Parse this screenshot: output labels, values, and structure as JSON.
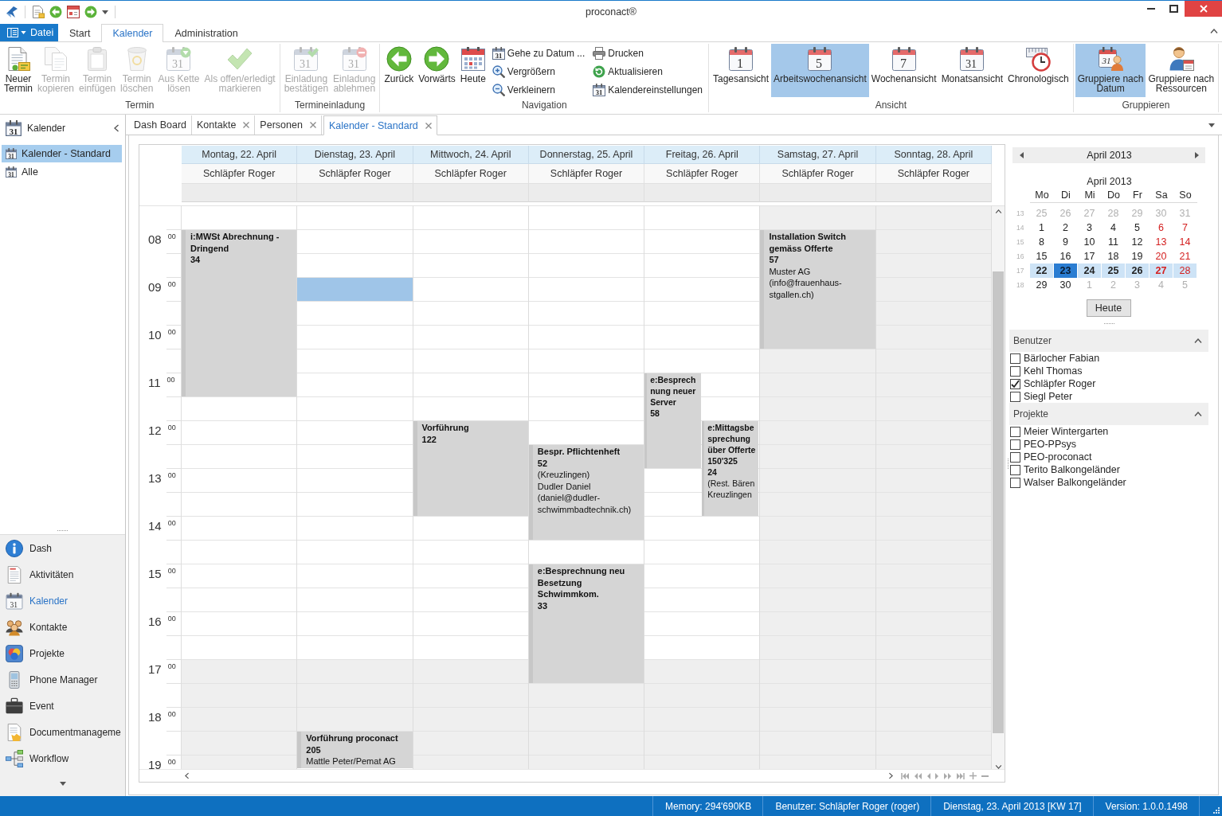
{
  "window": {
    "title": "proconact®"
  },
  "ribbon": {
    "file_button": "Datei",
    "tabs": [
      {
        "label": "Start",
        "selected": false
      },
      {
        "label": "Kalender",
        "selected": true
      },
      {
        "label": "Administration",
        "selected": false
      }
    ],
    "groups": [
      {
        "label": "Termin",
        "items": [
          {
            "kind": "large",
            "lines": [
              "Neuer",
              "Termin"
            ],
            "disabled": false
          },
          {
            "kind": "large",
            "lines": [
              "Termin",
              "kopieren"
            ],
            "disabled": true
          },
          {
            "kind": "large",
            "lines": [
              "Termin",
              "einfügen"
            ],
            "disabled": true
          },
          {
            "kind": "large",
            "lines": [
              "Termin",
              "löschen"
            ],
            "disabled": true
          },
          {
            "kind": "large",
            "lines": [
              "Aus Kette",
              "lösen"
            ],
            "disabled": true,
            "icon_text": "31"
          },
          {
            "kind": "large",
            "lines": [
              "Als offen/erledigt",
              "markieren"
            ],
            "disabled": true
          }
        ]
      },
      {
        "label": "Termineinladung",
        "items": [
          {
            "kind": "large",
            "lines": [
              "Einladung",
              "bestätigen"
            ],
            "disabled": true,
            "icon_text": "31"
          },
          {
            "kind": "large",
            "lines": [
              "Einladung",
              "ablehmen"
            ],
            "disabled": true,
            "icon_text": "31"
          }
        ]
      },
      {
        "label": "Navigation",
        "items": [
          {
            "kind": "large",
            "lines": [
              "Zurück"
            ],
            "disabled": false
          },
          {
            "kind": "large",
            "lines": [
              "Vorwärts"
            ],
            "disabled": false
          },
          {
            "kind": "large",
            "lines": [
              "Heute"
            ],
            "disabled": false
          },
          {
            "kind": "small",
            "lines": [
              "Gehe zu Datum ..."
            ],
            "disabled": false,
            "icon_text": "31"
          },
          {
            "kind": "small",
            "lines": [
              "Vergrößern"
            ],
            "disabled": false
          },
          {
            "kind": "small",
            "lines": [
              "Verkleinern"
            ],
            "disabled": false
          },
          {
            "kind": "small",
            "lines": [
              "Drucken"
            ],
            "disabled": false
          },
          {
            "kind": "small",
            "lines": [
              "Aktualisieren"
            ],
            "disabled": false
          },
          {
            "kind": "small",
            "lines": [
              "Kalendereinstellungen"
            ],
            "disabled": false,
            "icon_text": "31"
          }
        ]
      },
      {
        "label": "Ansicht",
        "items": [
          {
            "kind": "large",
            "lines": [
              "Tagesansicht"
            ],
            "disabled": false,
            "selected": false,
            "icon_text": "1"
          },
          {
            "kind": "large",
            "lines": [
              "Arbeitswochenansicht"
            ],
            "disabled": false,
            "selected": true,
            "icon_text": "5"
          },
          {
            "kind": "large",
            "lines": [
              "Wochenansicht"
            ],
            "disabled": false,
            "selected": false,
            "icon_text": "7"
          },
          {
            "kind": "large",
            "lines": [
              "Monatsansicht"
            ],
            "disabled": false,
            "selected": false,
            "icon_text": "31"
          },
          {
            "kind": "large",
            "lines": [
              "Chronologisch"
            ],
            "disabled": false,
            "selected": false
          }
        ]
      },
      {
        "label": "Gruppieren",
        "items": [
          {
            "kind": "large",
            "lines": [
              "Gruppiere nach",
              "Datum"
            ],
            "disabled": false,
            "selected": true,
            "icon_text": "31"
          },
          {
            "kind": "large",
            "lines": [
              "Gruppiere nach",
              "Ressourcen"
            ],
            "disabled": false,
            "selected": false
          }
        ]
      }
    ]
  },
  "sidebar": {
    "title": "Kalender",
    "icon_text": "31",
    "tree": [
      {
        "label": "Kalender - Standard",
        "icon_text": "31",
        "selected": true
      },
      {
        "label": "Alle",
        "icon_text": "31",
        "selected": false
      }
    ],
    "nav": [
      {
        "label": "Dash",
        "selected": false
      },
      {
        "label": "Aktivitäten",
        "selected": false
      },
      {
        "label": "Kalender",
        "icon_text": "31",
        "selected": true
      },
      {
        "label": "Kontakte",
        "selected": false
      },
      {
        "label": "Projekte",
        "selected": false
      },
      {
        "label": "Phone Manager",
        "selected": false
      },
      {
        "label": "Event",
        "selected": false
      },
      {
        "label": "Documentmanageme",
        "selected": false
      },
      {
        "label": "Workflow",
        "selected": false
      }
    ]
  },
  "document_tabs": [
    {
      "label": "Dash Board",
      "closable": false,
      "selected": false
    },
    {
      "label": "Kontakte",
      "closable": true,
      "selected": false
    },
    {
      "label": "Personen",
      "closable": true,
      "selected": false
    },
    {
      "label": "Kalender - Standard",
      "closable": true,
      "selected": true
    }
  ],
  "calendar": {
    "hours": [
      {
        "hour": "08",
        "minutes": "00",
        "working": true
      },
      {
        "hour": "09",
        "minutes": "00",
        "working": true
      },
      {
        "hour": "10",
        "minutes": "00",
        "working": true
      },
      {
        "hour": "11",
        "minutes": "00",
        "working": true
      },
      {
        "hour": "12",
        "minutes": "00",
        "working": true
      },
      {
        "hour": "13",
        "minutes": "00",
        "working": true
      },
      {
        "hour": "14",
        "minutes": "00",
        "working": true
      },
      {
        "hour": "15",
        "minutes": "00",
        "working": true
      },
      {
        "hour": "16",
        "minutes": "00",
        "working": true
      },
      {
        "hour": "17",
        "minutes": "00",
        "working": false
      },
      {
        "hour": "18",
        "minutes": "00",
        "working": false
      },
      {
        "hour": "19",
        "minutes": "00",
        "working": false
      }
    ],
    "days": [
      {
        "label": "Montag, 22. April",
        "resource": "Schläpfer Roger",
        "weekend": false,
        "selected": false,
        "events": [
          {
            "title": "i:MWSt Abrechnung - Dringend",
            "number": "34"
          }
        ]
      },
      {
        "label": "Dienstag, 23. April",
        "resource": "Schläpfer Roger",
        "weekend": false,
        "selected": true,
        "events": [
          {
            "title": "Vorführung proconact",
            "number": "205",
            "details": [
              "Mattle Peter/Pemat AG"
            ]
          }
        ]
      },
      {
        "label": "Mittwoch, 24. April",
        "resource": "Schläpfer Roger",
        "weekend": false,
        "selected": false,
        "events": [
          {
            "title": "Vorführung",
            "number": "122"
          }
        ]
      },
      {
        "label": "Donnerstag, 25. April",
        "resource": "Schläpfer Roger",
        "weekend": false,
        "selected": false,
        "events": [
          {
            "title": "Bespr. Pflichtenheft",
            "number": "52",
            "details": [
              "(Kreuzlingen)",
              "Dudler Daniel",
              "(daniel@dudler-schwimmbadtechnik.ch)"
            ]
          },
          {
            "title": "e:Besprechnung neu Besetzung Schwimmkom.",
            "number": "33"
          }
        ]
      },
      {
        "label": "Freitag, 26. April",
        "resource": "Schläpfer Roger",
        "weekend": false,
        "selected": false,
        "events": [
          {
            "title": "e:Besprechnung neuer Server",
            "number": "58"
          },
          {
            "title": "e:Mittagsbesprechung über Offerte 150'325",
            "number": "24",
            "details": [
              "(Rest. Bären Kreuzlingen"
            ]
          }
        ]
      },
      {
        "label": "Samstag, 27. April",
        "resource": "Schläpfer Roger",
        "weekend": true,
        "selected": false,
        "events": [
          {
            "title": "Installation Switch gemäss Offerte",
            "number": "57",
            "details": [
              "Muster AG",
              "(info@frauenhaus-stgallen.ch)"
            ]
          }
        ]
      },
      {
        "label": "Sonntag, 28. April",
        "resource": "Schläpfer Roger",
        "weekend": true,
        "selected": false
      }
    ]
  },
  "mini_calendar": {
    "title": "April 2013",
    "month_label": "April 2013",
    "weekdays": [
      "Mo",
      "Di",
      "Mi",
      "Do",
      "Fr",
      "Sa",
      "So"
    ],
    "weeks": [
      {
        "number": "13",
        "selected": false,
        "days": [
          {
            "day": "25",
            "other_month": true,
            "has_events": false,
            "selected": false
          },
          {
            "day": "26",
            "other_month": true,
            "has_events": false,
            "selected": false
          },
          {
            "day": "27",
            "other_month": true,
            "has_events": false,
            "selected": false
          },
          {
            "day": "28",
            "other_month": true,
            "has_events": false,
            "selected": false
          },
          {
            "day": "29",
            "other_month": true,
            "has_events": false,
            "selected": false
          },
          {
            "day": "30",
            "other_month": true,
            "has_events": false,
            "selected": false
          },
          {
            "day": "31",
            "other_month": true,
            "has_events": false,
            "selected": false
          }
        ]
      },
      {
        "number": "14",
        "selected": false,
        "days": [
          {
            "day": "1",
            "other_month": false,
            "has_events": false,
            "selected": false
          },
          {
            "day": "2",
            "other_month": false,
            "has_events": false,
            "selected": false
          },
          {
            "day": "3",
            "other_month": false,
            "has_events": false,
            "selected": false
          },
          {
            "day": "4",
            "other_month": false,
            "has_events": false,
            "selected": false
          },
          {
            "day": "5",
            "other_month": false,
            "has_events": false,
            "selected": false
          },
          {
            "day": "6",
            "other_month": false,
            "has_events": false,
            "selected": false
          },
          {
            "day": "7",
            "other_month": false,
            "has_events": false,
            "selected": false
          }
        ]
      },
      {
        "number": "15",
        "selected": false,
        "days": [
          {
            "day": "8",
            "other_month": false,
            "has_events": false,
            "selected": false
          },
          {
            "day": "9",
            "other_month": false,
            "has_events": false,
            "selected": false
          },
          {
            "day": "10",
            "other_month": false,
            "has_events": false,
            "selected": false
          },
          {
            "day": "11",
            "other_month": false,
            "has_events": false,
            "selected": false
          },
          {
            "day": "12",
            "other_month": false,
            "has_events": false,
            "selected": false
          },
          {
            "day": "13",
            "other_month": false,
            "has_events": false,
            "selected": false
          },
          {
            "day": "14",
            "other_month": false,
            "has_events": false,
            "selected": false
          }
        ]
      },
      {
        "number": "16",
        "selected": false,
        "days": [
          {
            "day": "15",
            "other_month": false,
            "has_events": false,
            "selected": false
          },
          {
            "day": "16",
            "other_month": false,
            "has_events": false,
            "selected": false
          },
          {
            "day": "17",
            "other_month": false,
            "has_events": false,
            "selected": false
          },
          {
            "day": "18",
            "other_month": false,
            "has_events": false,
            "selected": false
          },
          {
            "day": "19",
            "other_month": false,
            "has_events": false,
            "selected": false
          },
          {
            "day": "20",
            "other_month": false,
            "has_events": false,
            "selected": false
          },
          {
            "day": "21",
            "other_month": false,
            "has_events": false,
            "selected": false
          }
        ]
      },
      {
        "number": "17",
        "selected": true,
        "days": [
          {
            "day": "22",
            "other_month": false,
            "has_events": true,
            "selected": false
          },
          {
            "day": "23",
            "other_month": false,
            "has_events": true,
            "selected": true
          },
          {
            "day": "24",
            "other_month": false,
            "has_events": true,
            "selected": false
          },
          {
            "day": "25",
            "other_month": false,
            "has_events": true,
            "selected": false
          },
          {
            "day": "26",
            "other_month": false,
            "has_events": true,
            "selected": false
          },
          {
            "day": "27",
            "other_month": false,
            "has_events": true,
            "selected": false
          },
          {
            "day": "28",
            "other_month": false,
            "has_events": false,
            "selected": false
          }
        ]
      },
      {
        "number": "18",
        "selected": false,
        "days": [
          {
            "day": "29",
            "other_month": false,
            "has_events": false,
            "selected": false
          },
          {
            "day": "30",
            "other_month": false,
            "has_events": false,
            "selected": false
          },
          {
            "day": "1",
            "other_month": true,
            "has_events": false,
            "selected": false
          },
          {
            "day": "2",
            "other_month": true,
            "has_events": false,
            "selected": false
          },
          {
            "day": "3",
            "other_month": true,
            "has_events": false,
            "selected": false
          },
          {
            "day": "4",
            "other_month": true,
            "has_events": false,
            "selected": false
          },
          {
            "day": "5",
            "other_month": true,
            "has_events": false,
            "selected": false
          }
        ]
      }
    ],
    "today_button": "Heute"
  },
  "filters": [
    {
      "title": "Benutzer",
      "expanded": true,
      "items": [
        {
          "label": "Bärlocher Fabian",
          "checked": false
        },
        {
          "label": "Kehl Thomas",
          "checked": false
        },
        {
          "label": "Schläpfer Roger",
          "checked": true
        },
        {
          "label": "Siegl Peter",
          "checked": false
        }
      ]
    },
    {
      "title": "Projekte",
      "expanded": true,
      "items": [
        {
          "label": "Meier Wintergarten",
          "checked": false
        },
        {
          "label": "PEO-PPsys",
          "checked": false
        },
        {
          "label": "PEO-proconact",
          "checked": false
        },
        {
          "label": "Terito Balkongeländer",
          "checked": false
        },
        {
          "label": "Walser Balkongeländer",
          "checked": false
        }
      ]
    }
  ],
  "status_bar": [
    "Memory: 294'690KB",
    "Benutzer: Schläpfer Roger (roger)",
    "Dienstag, 23. April 2013 [KW 17]",
    "Version: 1.0.0.1498"
  ]
}
